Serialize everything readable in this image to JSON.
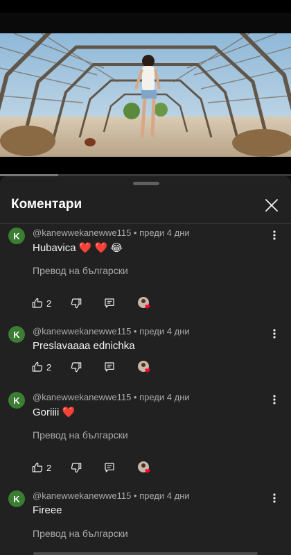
{
  "sheet": {
    "title": "Коментари"
  },
  "icons": {
    "close": "close-icon",
    "more": "more-vertical-icon",
    "like": "thumbs-up-icon",
    "dislike": "thumbs-down-icon",
    "reply": "reply-icon",
    "heart": "creator-heart-icon"
  },
  "video": {
    "progress": 0.2
  },
  "colors": {
    "avatar": "#3b7d32",
    "heart": "#ff0033",
    "sheet_bg": "#212121"
  },
  "comments": [
    {
      "avatar_letter": "K",
      "meta": "@kanewwekanewwe115 • преди 4 дни",
      "text": "Hubavica ❤️ ❤️ 😂",
      "translate": "Превод на български",
      "likes": "2"
    },
    {
      "avatar_letter": "K",
      "meta": "@kanewwekanewwe115 • преди 4 дни",
      "text": "Preslavaaaa ednichka",
      "translate": "",
      "likes": "2"
    },
    {
      "avatar_letter": "K",
      "meta": "@kanewwekanewwe115 • преди 4 дни",
      "text": "Goriiii ❤️",
      "translate": "Превод на български",
      "likes": "2"
    },
    {
      "avatar_letter": "K",
      "meta": "@kanewwekanewwe115 • преди 4 дни",
      "text": "Fireee",
      "translate": "Превод на български",
      "likes": ""
    }
  ]
}
